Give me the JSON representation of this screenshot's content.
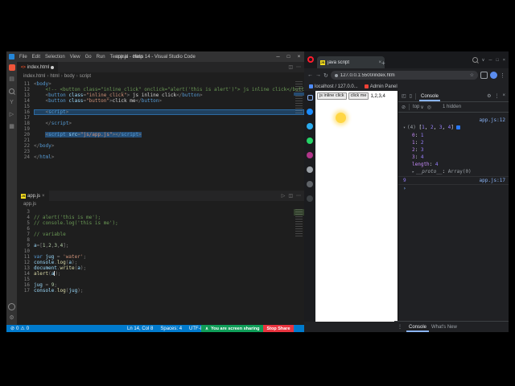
{
  "colors": {
    "statusbar": "#007acc",
    "share_green": "#0f9d58",
    "share_red": "#e8343f",
    "devtools_accent": "#8ab4f8",
    "selection": "#264f78"
  },
  "icons": {
    "min": "─",
    "max": "□",
    "close": "×",
    "plus": "+",
    "kebab": "⋮",
    "dots": "⋯",
    "gear": "⚙",
    "star": "☆",
    "back": "←",
    "fwd": "→",
    "reload": "↻",
    "chev_down": "∨",
    "chev_up": "∧",
    "crumb_sep": "›",
    "tree_open": "▾",
    "tree_closed": "▸",
    "prompt": "›",
    "clear": "⊘",
    "error": "⊘",
    "warn": "⚠",
    "files": "▤",
    "scm": "Y",
    "debug": "▷",
    "ext": "▦",
    "split": "◫",
    "inspect": "◰",
    "device": "▯",
    "eye": "◎",
    "html": "<>",
    "js_label": "JS"
  },
  "vscode": {
    "title": "app.js - class 14 - Visual Studio Code",
    "menus": [
      "File",
      "Edit",
      "Selection",
      "View",
      "Go",
      "Run",
      "Terminal",
      "Help"
    ],
    "top_editor": {
      "tab_label": "index.html",
      "breadcrumb": [
        "index.html",
        "html",
        "body",
        "script"
      ],
      "lines": [
        {
          "n": "11",
          "s": [
            [
              "pu",
              "<"
            ],
            [
              "tag",
              "body"
            ],
            [
              "pu",
              ">"
            ]
          ]
        },
        {
          "n": "12",
          "s": [
            [
              "com",
              "    <!-- <button class=\"inline_click\" onclick=\"alert('this is alert')\"> js inline click</button> -->"
            ]
          ]
        },
        {
          "n": "13",
          "s": [
            [
              "pu",
              "    <"
            ],
            [
              "tag",
              "button"
            ],
            [
              "attr",
              " class"
            ],
            [
              "pu",
              "="
            ],
            [
              "str",
              "\"inline_click\""
            ],
            [
              "pu",
              "> "
            ],
            [
              "txt",
              "js inline click"
            ],
            [
              "pu",
              "</"
            ],
            [
              "tag",
              "button"
            ],
            [
              "pu",
              ">"
            ]
          ]
        },
        {
          "n": "14",
          "s": [
            [
              "pu",
              "    <"
            ],
            [
              "tag",
              "button"
            ],
            [
              "attr",
              " class"
            ],
            [
              "pu",
              "="
            ],
            [
              "str",
              "\"button\""
            ],
            [
              "pu",
              ">"
            ],
            [
              "txt",
              "click me"
            ],
            [
              "pu",
              "</"
            ],
            [
              "tag",
              "button"
            ],
            [
              "pu",
              ">"
            ]
          ]
        },
        {
          "n": "15",
          "s": []
        },
        {
          "n": "16",
          "band": true,
          "s": [
            [
              "pu",
              "    <"
            ],
            [
              "tag",
              "script"
            ],
            [
              "pu",
              ">"
            ]
          ]
        },
        {
          "n": "17",
          "s": []
        },
        {
          "n": "18",
          "s": [
            [
              "pu",
              "    </"
            ],
            [
              "tag",
              "script"
            ],
            [
              "pu",
              ">"
            ]
          ]
        },
        {
          "n": "19",
          "s": []
        },
        {
          "n": "20",
          "s": [
            [
              "pu",
              "    "
            ],
            [
              "pu sel",
              "<"
            ],
            [
              "tag sel",
              "script"
            ],
            [
              "attr sel",
              " src"
            ],
            [
              "pu sel",
              "="
            ],
            [
              "str sel",
              "\"js/app.js\""
            ],
            [
              "pu sel",
              "></"
            ],
            [
              "tag sel",
              "script"
            ],
            [
              "pu sel",
              ">"
            ]
          ]
        },
        {
          "n": "21",
          "s": []
        },
        {
          "n": "22",
          "s": [
            [
              "pu",
              "</"
            ],
            [
              "tag",
              "body"
            ],
            [
              "pu",
              ">"
            ]
          ]
        },
        {
          "n": "23",
          "s": []
        },
        {
          "n": "24",
          "s": [
            [
              "pu",
              "</"
            ],
            [
              "tag",
              "html"
            ],
            [
              "pu",
              ">"
            ]
          ]
        }
      ]
    },
    "bottom_editor": {
      "tab_label": "app.js",
      "breadcrumb": [
        "app.js"
      ],
      "lines": [
        {
          "n": "3",
          "s": []
        },
        {
          "n": "4",
          "s": [
            [
              "com",
              "// alert('this is me');"
            ]
          ]
        },
        {
          "n": "5",
          "s": [
            [
              "com",
              "// console.log('this is me');"
            ]
          ]
        },
        {
          "n": "6",
          "s": []
        },
        {
          "n": "7",
          "s": [
            [
              "com",
              "// variable"
            ]
          ]
        },
        {
          "n": "8",
          "s": []
        },
        {
          "n": "9",
          "s": [
            [
              "var",
              "a"
            ],
            [
              "pu",
              "=["
            ],
            [
              "num",
              "1"
            ],
            [
              "pu",
              ","
            ],
            [
              "num",
              "2"
            ],
            [
              "pu",
              ","
            ],
            [
              "num",
              "3"
            ],
            [
              "pu",
              ","
            ],
            [
              "num",
              "4"
            ],
            [
              "pu",
              "];"
            ]
          ]
        },
        {
          "n": "10",
          "s": []
        },
        {
          "n": "11",
          "s": [
            [
              "kw",
              "var"
            ],
            [
              "var",
              " jug "
            ],
            [
              "pu",
              "= "
            ],
            [
              "str",
              "'water'"
            ],
            [
              "pu",
              ";"
            ]
          ]
        },
        {
          "n": "12",
          "s": [
            [
              "var",
              "console"
            ],
            [
              "pu",
              "."
            ],
            [
              "fn",
              "log"
            ],
            [
              "pu",
              "("
            ],
            [
              "var",
              "a"
            ],
            [
              "pu",
              ");"
            ]
          ]
        },
        {
          "n": "13",
          "s": [
            [
              "var",
              "document"
            ],
            [
              "pu",
              "."
            ],
            [
              "fn",
              "write"
            ],
            [
              "pu",
              "("
            ],
            [
              "var",
              "a"
            ],
            [
              "pu",
              ");"
            ]
          ]
        },
        {
          "n": "14",
          "s": [
            [
              "fn",
              "alert"
            ],
            [
              "pu",
              "("
            ],
            [
              "var",
              "a"
            ],
            [
              "caret",
              ""
            ],
            [
              "pu",
              ");"
            ]
          ]
        },
        {
          "n": "15",
          "s": []
        },
        {
          "n": "16",
          "s": [
            [
              "var",
              "jug "
            ],
            [
              "pu",
              "= "
            ],
            [
              "num",
              "9"
            ],
            [
              "pu",
              ";"
            ]
          ]
        },
        {
          "n": "17",
          "s": [
            [
              "var",
              "console"
            ],
            [
              "pu",
              "."
            ],
            [
              "fn",
              "log"
            ],
            [
              "pu",
              "("
            ],
            [
              "var",
              "jug"
            ],
            [
              "pu",
              ");"
            ]
          ]
        }
      ]
    },
    "status": {
      "problems": "0",
      "warnings": "0",
      "right": [
        "Ln 14, Col 8",
        "Spaces: 4",
        "UTF-8"
      ]
    }
  },
  "share": {
    "message": "You are screen sharing",
    "stop": "Stop Share"
  },
  "sidebar_apps": [
    {
      "name": "workspaces-icon",
      "color": "#8ab4f8",
      "type": "square"
    },
    {
      "name": "messenger-icon",
      "color": "#1a8cff"
    },
    {
      "name": "telegram-icon",
      "color": "#2aabee"
    },
    {
      "name": "whatsapp-icon",
      "color": "#25d366"
    },
    {
      "name": "instagram-icon",
      "color": "#b13589"
    },
    {
      "name": "history-icon",
      "color": "#9aa0a6"
    },
    {
      "name": "bookmarks-sidebar-icon",
      "color": "#5f6368"
    },
    {
      "name": "downloads-icon",
      "color": "#3c4043"
    }
  ],
  "browser": {
    "tab_title": "java script",
    "url": "127.0.0.1:5500/index.htm",
    "bookmarks": [
      {
        "label": "localhost / 127.0.0...",
        "color": "#4e8cff"
      },
      {
        "label": "Admin Panel",
        "color": "#ef4136"
      }
    ],
    "page": {
      "buttons": [
        "js inline click",
        "click me"
      ],
      "output": "1,2,3,4"
    },
    "devtools": {
      "panel_tab": "Console",
      "filter_scope": "top",
      "hidden_count": "1 hidden",
      "console_rows": [
        {
          "type": "src",
          "link": "app.js:12"
        },
        {
          "type": "array",
          "parts": [
            [
              "dim",
              "(4) "
            ],
            [
              "pn",
              "["
            ],
            [
              "num",
              "1"
            ],
            [
              "pn",
              ", "
            ],
            [
              "num",
              "2"
            ],
            [
              "pn",
              ", "
            ],
            [
              "num",
              "3"
            ],
            [
              "pn",
              ", "
            ],
            [
              "num",
              "4"
            ],
            [
              "pn",
              "]"
            ]
          ],
          "info": true
        },
        {
          "type": "prop",
          "key": "0",
          "val": "1"
        },
        {
          "type": "prop",
          "key": "1",
          "val": "2"
        },
        {
          "type": "prop",
          "key": "2",
          "val": "3"
        },
        {
          "type": "prop",
          "key": "3",
          "val": "4"
        },
        {
          "type": "prop",
          "key": "length",
          "val": "4"
        },
        {
          "type": "proto",
          "key": "__proto__",
          "val": "Array(0)"
        },
        {
          "type": "result",
          "val": "9",
          "link": "app.js:17"
        },
        {
          "type": "prompt"
        }
      ],
      "drawer_tabs": [
        {
          "label": "Console",
          "active": true
        },
        {
          "label": "What's New",
          "active": false
        }
      ]
    }
  }
}
